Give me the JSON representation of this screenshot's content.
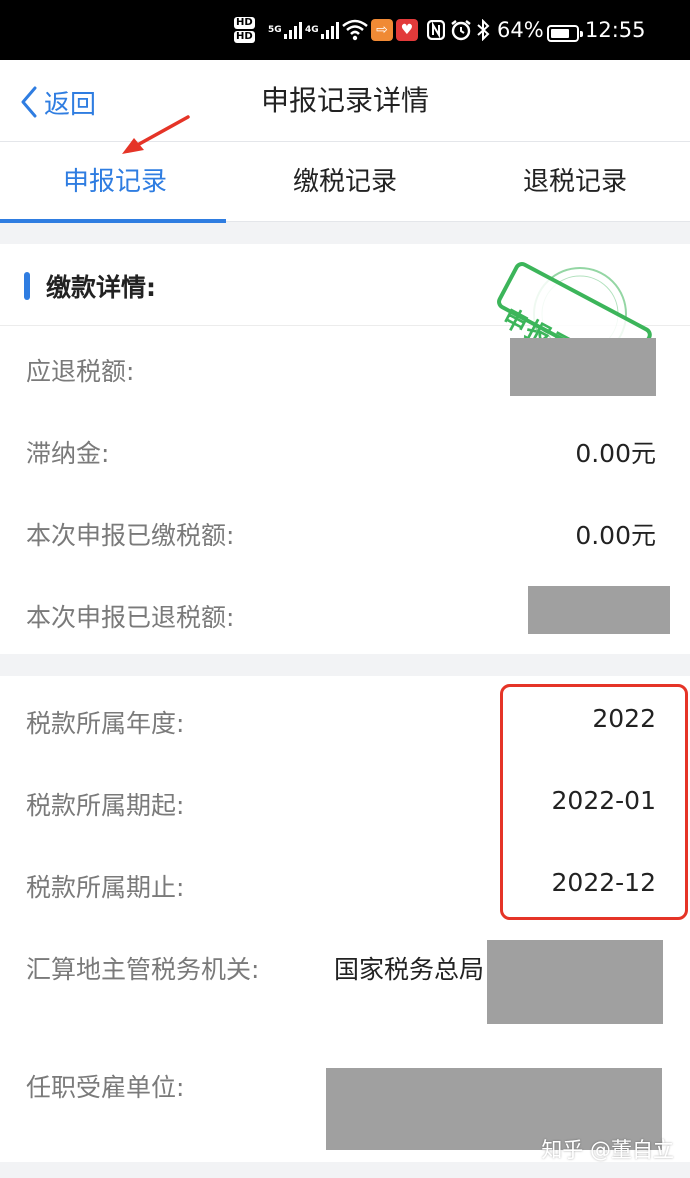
{
  "status_bar": {
    "hd1": "HD",
    "hd2": "HD",
    "net1": "5G",
    "net2": "4G",
    "battery_percent": "64%",
    "time": "12:55"
  },
  "nav": {
    "back_label": "返回",
    "title": "申报记录详情"
  },
  "tabs": [
    {
      "label": "申报记录",
      "active": true
    },
    {
      "label": "缴税记录",
      "active": false
    },
    {
      "label": "退税记录",
      "active": false
    }
  ],
  "payment_section": {
    "title": "缴款详情:",
    "stamp_text": "申报已完",
    "rows": [
      {
        "label": "应退税额:",
        "value": ""
      },
      {
        "label": "滞纳金:",
        "value": "0.00元"
      },
      {
        "label": "本次申报已缴税额:",
        "value": "0.00元"
      },
      {
        "label": "本次申报已退税额:",
        "value": ""
      }
    ]
  },
  "tax_section": {
    "rows": [
      {
        "label": "税款所属年度:",
        "value": "2022"
      },
      {
        "label": "税款所属期起:",
        "value": "2022-01"
      },
      {
        "label": "税款所属期止:",
        "value": "2022-12"
      },
      {
        "label": "汇算地主管税务机关:",
        "value": "国家税务总局"
      },
      {
        "label": "任职受雇单位:",
        "value": ""
      }
    ]
  },
  "watermark": "知乎 @董自立",
  "colors": {
    "accent": "#2f7de1",
    "annotation_red": "#e53427",
    "stamp_green": "#3cb55a",
    "redaction_gray": "#a0a0a0"
  }
}
